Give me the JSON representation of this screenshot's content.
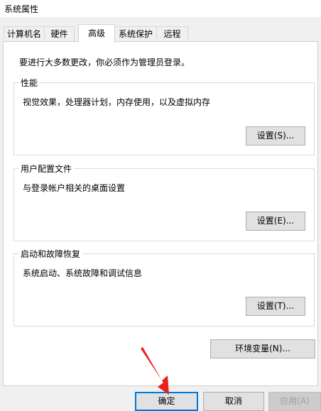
{
  "window": {
    "title": "系统属性"
  },
  "tabs": [
    {
      "label": "计算机名"
    },
    {
      "label": "硬件"
    },
    {
      "label": "高级",
      "active": true
    },
    {
      "label": "系统保护"
    },
    {
      "label": "远程"
    }
  ],
  "advanced": {
    "notice": "要进行大多数更改，你必须作为管理员登录。",
    "performance": {
      "title": "性能",
      "description": "视觉效果，处理器计划，内存使用，以及虚拟内存",
      "settings_label": "设置(S)..."
    },
    "user_profiles": {
      "title": "用户配置文件",
      "description": "与登录帐户相关的桌面设置",
      "settings_label": "设置(E)..."
    },
    "startup_recovery": {
      "title": "启动和故障恢复",
      "description": "系统启动、系统故障和调试信息",
      "settings_label": "设置(T)..."
    },
    "env_vars_label": "环境变量(N)..."
  },
  "dialog_buttons": {
    "ok_label": "确定",
    "cancel_label": "取消",
    "apply_label": "应用(A)"
  },
  "colors": {
    "accent": "#0078d7",
    "annotation_arrow": "#e8211e"
  }
}
